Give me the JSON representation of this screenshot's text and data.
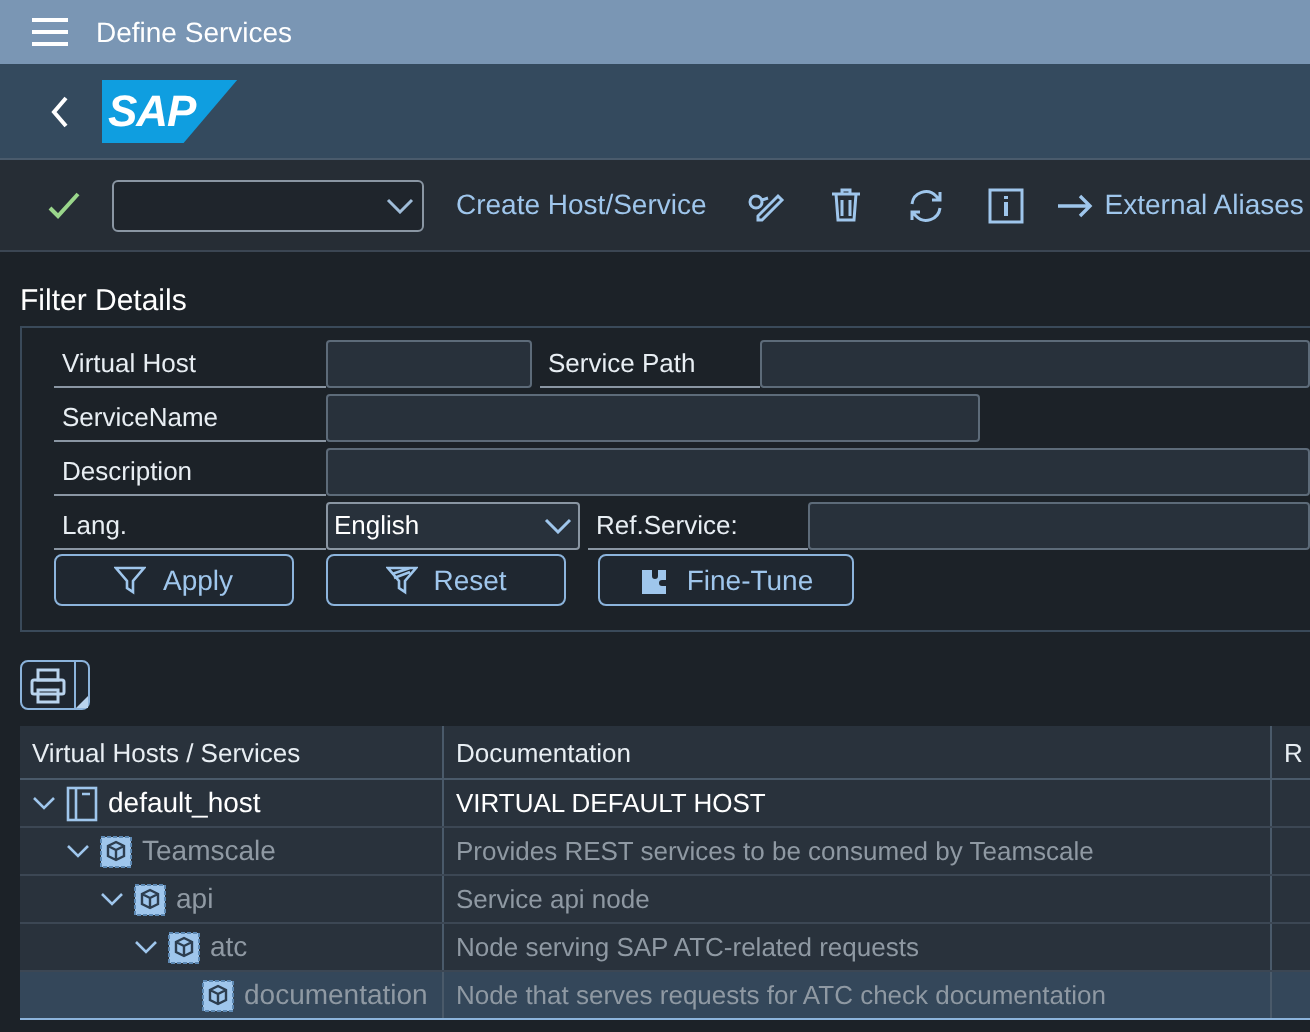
{
  "window": {
    "title": "Define Services"
  },
  "header": {
    "logo": "SAP"
  },
  "toolbar": {
    "buttons": [
      {
        "kind": "text",
        "label": "Create Host/Service"
      },
      {
        "kind": "display-change"
      },
      {
        "kind": "delete"
      },
      {
        "kind": "refresh"
      },
      {
        "kind": "info"
      },
      {
        "kind": "link",
        "label": "External Aliases"
      }
    ]
  },
  "filter": {
    "title": "Filter Details",
    "rows": [
      {
        "fields": [
          {
            "label": "Virtual Host",
            "kind": "input"
          },
          {
            "label": "Service Path",
            "kind": "input"
          }
        ]
      },
      {
        "fields": [
          {
            "label": "ServiceName",
            "kind": "input"
          }
        ]
      },
      {
        "fields": [
          {
            "label": "Description",
            "kind": "input"
          }
        ]
      },
      {
        "fields": [
          {
            "label": "Lang.",
            "kind": "select",
            "value": "English"
          },
          {
            "label": "Ref.Service:",
            "kind": "input"
          }
        ]
      }
    ],
    "buttons": [
      {
        "kind": "filter",
        "label": "Apply"
      },
      {
        "kind": "reset",
        "label": "Reset"
      },
      {
        "kind": "tune",
        "label": "Fine-Tune"
      }
    ]
  },
  "table": {
    "columns": [
      "Virtual Hosts / Services",
      "Documentation",
      "R"
    ],
    "rows": [
      {
        "kind": "host",
        "name": "default_host",
        "documentation": "VIRTUAL DEFAULT HOST",
        "active": true,
        "expanded": true,
        "selected": false,
        "children": [
          {
            "kind": "service",
            "name": "Teamscale",
            "documentation": "Provides REST services to be consumed by Teamscale",
            "active": false,
            "expanded": true,
            "selected": false,
            "children": [
              {
                "kind": "service",
                "name": "api",
                "documentation": "Service api node",
                "active": false,
                "expanded": true,
                "selected": false,
                "children": [
                  {
                    "kind": "service",
                    "name": "atc",
                    "documentation": "Node serving SAP ATC-related requests",
                    "active": false,
                    "expanded": true,
                    "selected": false,
                    "children": [
                      {
                        "kind": "service",
                        "name": "documentation",
                        "documentation": "Node that serves requests for ATC check documentation",
                        "active": false,
                        "selected": true
                      }
                    ]
                  }
                ]
              }
            ]
          }
        ]
      }
    ]
  }
}
